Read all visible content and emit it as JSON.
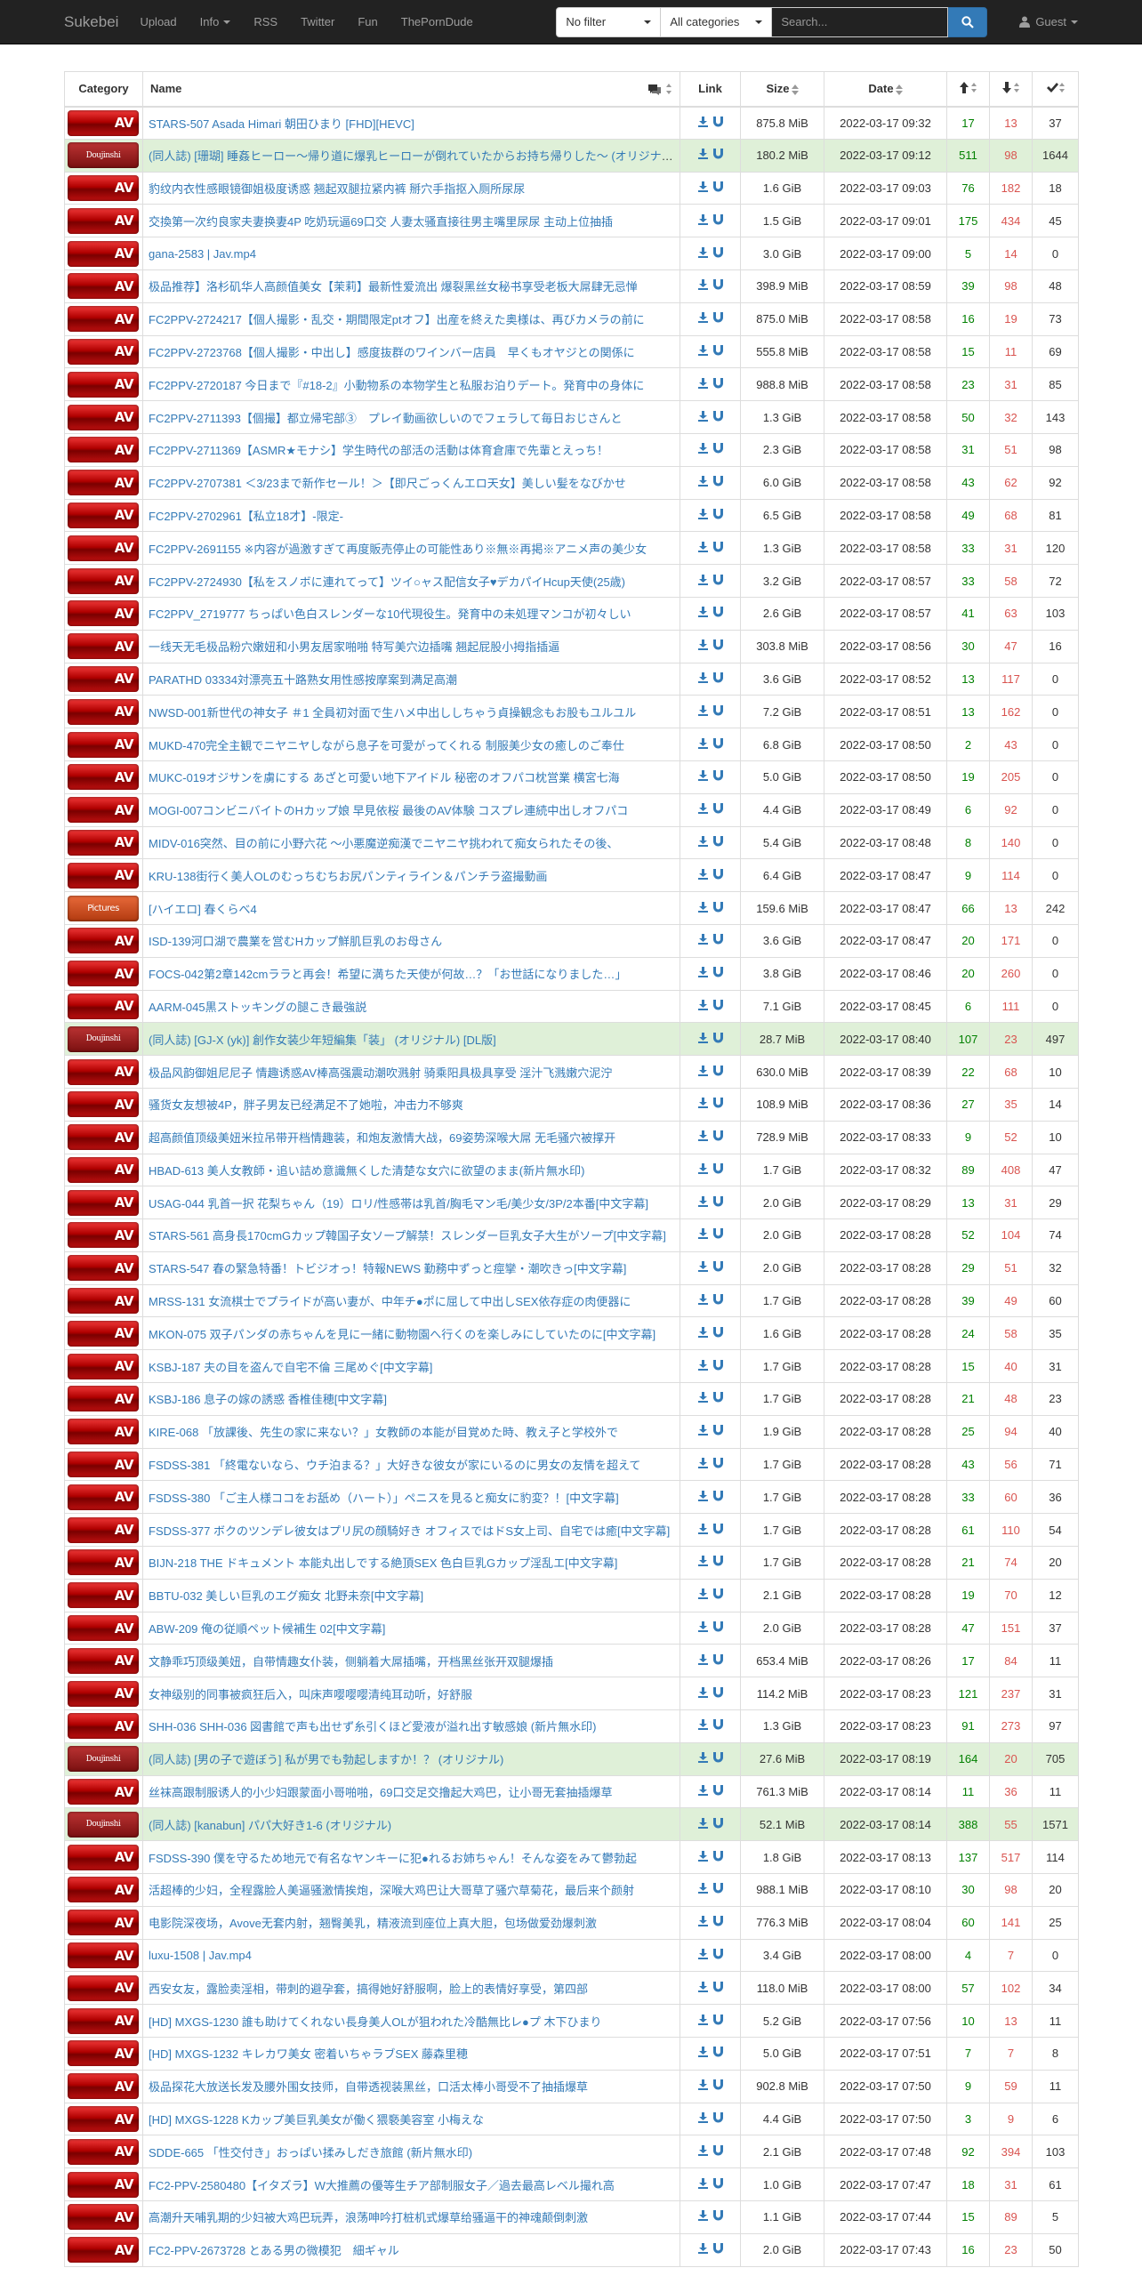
{
  "navbar": {
    "brand": "Sukebei",
    "links": [
      "Upload",
      "Info",
      "RSS",
      "Twitter",
      "Fun",
      "ThePornDude"
    ],
    "filter_value": "No filter",
    "category_value": "All categories",
    "search_placeholder": "Search...",
    "user_label": "Guest"
  },
  "table": {
    "headers": {
      "category": "Category",
      "name": "Name",
      "link": "Link",
      "size": "Size",
      "date": "Date"
    },
    "rows": [
      {
        "cat": "AV",
        "name": "STARS-507 Asada Himari 朝田ひまり [FHD][HEVC]",
        "size": "875.8 MiB",
        "date": "2022-03-17 09:32",
        "s": "17",
        "l": "13",
        "d": "37",
        "hl": false
      },
      {
        "cat": "Doujinshi",
        "name": "(同人誌) [珊瑚] 睡姦ヒーロー～帰り道に爆乳ヒーローが倒れていたからお持ち帰りした～ (オリジナル)",
        "size": "180.2 MiB",
        "date": "2022-03-17 09:12",
        "s": "511",
        "l": "98",
        "d": "1644",
        "hl": true
      },
      {
        "cat": "AV",
        "name": "豹纹内衣性感眼镜御姐极度诱惑 翘起双腿拉紧内裤 掰穴手指抠入厕所尿尿",
        "size": "1.6 GiB",
        "date": "2022-03-17 09:03",
        "s": "76",
        "l": "182",
        "d": "18",
        "hl": false
      },
      {
        "cat": "AV",
        "name": "交換第一次约良家夫妻换妻4P 吃奶玩逼69口交 人妻太骚直接往男主嘴里尿尿 主动上位抽插",
        "size": "1.5 GiB",
        "date": "2022-03-17 09:01",
        "s": "175",
        "l": "434",
        "d": "45",
        "hl": false
      },
      {
        "cat": "AV",
        "name": "gana-2583 | Jav.mp4",
        "size": "3.0 GiB",
        "date": "2022-03-17 09:00",
        "s": "5",
        "l": "14",
        "d": "0",
        "hl": false
      },
      {
        "cat": "AV",
        "name": "极品推荐】洛杉矶华人高颜值美女【茉莉】最新性爱流出 爆裂黑丝女秘书享受老板大屌肆无忌惮",
        "size": "398.9 MiB",
        "date": "2022-03-17 08:59",
        "s": "39",
        "l": "98",
        "d": "48",
        "hl": false
      },
      {
        "cat": "AV",
        "name": "FC2PPV-2724217【個人撮影・乱交・期間限定ptオフ】出産を終えた奥様は、再びカメラの前に",
        "size": "875.0 MiB",
        "date": "2022-03-17 08:58",
        "s": "16",
        "l": "19",
        "d": "73",
        "hl": false
      },
      {
        "cat": "AV",
        "name": "FC2PPV-2723768【個人撮影・中出し】感度抜群のワインバー店員　早くもオヤジとの関係に",
        "size": "555.8 MiB",
        "date": "2022-03-17 08:58",
        "s": "15",
        "l": "11",
        "d": "69",
        "hl": false
      },
      {
        "cat": "AV",
        "name": "FC2PPV-2720187 今日まで『#18-2』小動物系の本物学生と私服お泊りデート。発育中の身体に",
        "size": "988.8 MiB",
        "date": "2022-03-17 08:58",
        "s": "23",
        "l": "31",
        "d": "85",
        "hl": false
      },
      {
        "cat": "AV",
        "name": "FC2PPV-2711393【個撮】都立帰宅部③　プレイ動画欲しいのでフェラして毎日おじさんと",
        "size": "1.3 GiB",
        "date": "2022-03-17 08:58",
        "s": "50",
        "l": "32",
        "d": "143",
        "hl": false
      },
      {
        "cat": "AV",
        "name": "FC2PPV-2711369【ASMR★モナシ】学生時代の部活の活動は体育倉庫で先輩とえっち！",
        "size": "2.3 GiB",
        "date": "2022-03-17 08:58",
        "s": "31",
        "l": "51",
        "d": "98",
        "hl": false
      },
      {
        "cat": "AV",
        "name": "FC2PPV-2707381 ＜3/23まで新作セール！＞【即尺ごっくんエロ天女】美しい髪をなびかせ",
        "size": "6.0 GiB",
        "date": "2022-03-17 08:58",
        "s": "43",
        "l": "62",
        "d": "92",
        "hl": false
      },
      {
        "cat": "AV",
        "name": "FC2PPV-2702961【私立18才】-限定-",
        "size": "6.5 GiB",
        "date": "2022-03-17 08:58",
        "s": "49",
        "l": "68",
        "d": "81",
        "hl": false
      },
      {
        "cat": "AV",
        "name": "FC2PPV-2691155 ※内容が過激すぎて再度販売停止の可能性あり※無※再掲※アニメ声の美少女",
        "size": "1.3 GiB",
        "date": "2022-03-17 08:58",
        "s": "33",
        "l": "31",
        "d": "120",
        "hl": false
      },
      {
        "cat": "AV",
        "name": "FC2PPV-2724930【私をスノボに連れてって】ツイ○ャス配信女子♥デカパイHcup天使(25歳)",
        "size": "3.2 GiB",
        "date": "2022-03-17 08:57",
        "s": "33",
        "l": "58",
        "d": "72",
        "hl": false
      },
      {
        "cat": "AV",
        "name": "FC2PPV_2719777 ちっぱい色白スレンダーな10代現役生。発育中の未処理マンコが初々しい",
        "size": "2.6 GiB",
        "date": "2022-03-17 08:57",
        "s": "41",
        "l": "63",
        "d": "103",
        "hl": false
      },
      {
        "cat": "AV",
        "name": "一线天无毛极品粉穴嫩妞和小男友居家啪啪 特写美穴边插嘴 翘起屁股小拇指插逼",
        "size": "303.8 MiB",
        "date": "2022-03-17 08:56",
        "s": "30",
        "l": "47",
        "d": "16",
        "hl": false
      },
      {
        "cat": "AV",
        "name": "PARATHD 03334対漂亮五十路熟女用性感按摩案到满足高潮",
        "size": "3.6 GiB",
        "date": "2022-03-17 08:52",
        "s": "13",
        "l": "117",
        "d": "0",
        "hl": false
      },
      {
        "cat": "AV",
        "name": "NWSD-001新世代の神女子 ＃1 全員初対面で生ハメ中出ししちゃう貞操観念もお股もユルユル",
        "size": "7.2 GiB",
        "date": "2022-03-17 08:51",
        "s": "13",
        "l": "162",
        "d": "0",
        "hl": false
      },
      {
        "cat": "AV",
        "name": "MUKD-470完全主観でニヤニヤしながら息子を可愛がってくれる 制服美少女の癒しのご奉仕",
        "size": "6.8 GiB",
        "date": "2022-03-17 08:50",
        "s": "2",
        "l": "43",
        "d": "0",
        "hl": false
      },
      {
        "cat": "AV",
        "name": "MUKC-019オジサンを虜にする あざと可愛い地下アイドル 秘密のオフパコ枕営業 横宮七海",
        "size": "5.0 GiB",
        "date": "2022-03-17 08:50",
        "s": "19",
        "l": "205",
        "d": "0",
        "hl": false
      },
      {
        "cat": "AV",
        "name": "MOGI-007コンビニバイトのHカップ娘 早見依桜 最後のAV体験 コスプレ連続中出しオフパコ",
        "size": "4.4 GiB",
        "date": "2022-03-17 08:49",
        "s": "6",
        "l": "92",
        "d": "0",
        "hl": false
      },
      {
        "cat": "AV",
        "name": "MIDV-016突然、目の前に小野六花 ～小悪魔逆痴漢でニヤニヤ挑われて痴女られたその後、",
        "size": "5.4 GiB",
        "date": "2022-03-17 08:48",
        "s": "8",
        "l": "140",
        "d": "0",
        "hl": false
      },
      {
        "cat": "AV",
        "name": "KRU-138街行く美人OLのむっちむちお尻パンティライン＆パンチラ盗撮動画",
        "size": "6.4 GiB",
        "date": "2022-03-17 08:47",
        "s": "9",
        "l": "114",
        "d": "0",
        "hl": false
      },
      {
        "cat": "Pictures",
        "name": "[ハイエロ] 春くらべ4",
        "size": "159.6 MiB",
        "date": "2022-03-17 08:47",
        "s": "66",
        "l": "13",
        "d": "242",
        "hl": false
      },
      {
        "cat": "AV",
        "name": "ISD-139河口湖で農業を営むHカップ鮮肌巨乳のお母さん",
        "size": "3.6 GiB",
        "date": "2022-03-17 08:47",
        "s": "20",
        "l": "171",
        "d": "0",
        "hl": false
      },
      {
        "cat": "AV",
        "name": "FOCS-042第2章142cmララと再会！希望に満ちた天使が何故…？「お世話になりました…」",
        "size": "3.8 GiB",
        "date": "2022-03-17 08:46",
        "s": "20",
        "l": "260",
        "d": "0",
        "hl": false
      },
      {
        "cat": "AV",
        "name": "AARM-045黒ストッキングの腿こき最強説",
        "size": "7.1 GiB",
        "date": "2022-03-17 08:45",
        "s": "6",
        "l": "111",
        "d": "0",
        "hl": false
      },
      {
        "cat": "Doujinshi",
        "name": "(同人誌) [GJ-X (yk)] 創作女装少年短編集「装」 (オリジナル) [DL版]",
        "size": "28.7 MiB",
        "date": "2022-03-17 08:40",
        "s": "107",
        "l": "23",
        "d": "497",
        "hl": true
      },
      {
        "cat": "AV",
        "name": "极品风韵御姐尼尼子 情趣诱惑AV棒高强震动潮吹溅射 骑乘阳具极具享受 淫汁飞溅嫩穴泥泞",
        "size": "630.0 MiB",
        "date": "2022-03-17 08:39",
        "s": "22",
        "l": "68",
        "d": "10",
        "hl": false
      },
      {
        "cat": "AV",
        "name": "骚货女友想被4P，胖子男友已经满足不了她啦，冲击力不够爽",
        "size": "108.9 MiB",
        "date": "2022-03-17 08:36",
        "s": "27",
        "l": "35",
        "d": "14",
        "hl": false
      },
      {
        "cat": "AV",
        "name": "超高颜值顶级美妞米拉吊带开档情趣装，和炮友激情大战，69姿势深喉大屌 无毛骚穴被撑开",
        "size": "728.9 MiB",
        "date": "2022-03-17 08:33",
        "s": "9",
        "l": "52",
        "d": "10",
        "hl": false
      },
      {
        "cat": "AV",
        "name": "HBAD-613 美人女教師・追い詰め意識無くした清楚な女穴に欲望のまま(新片無水印)",
        "size": "1.7 GiB",
        "date": "2022-03-17 08:32",
        "s": "89",
        "l": "408",
        "d": "47",
        "hl": false
      },
      {
        "cat": "AV",
        "name": "USAG-044 乳首一択 花梨ちゃん（19）ロリ/性感帯は乳首/胸毛マン毛/美少女/3P/2本番[中文字幕]",
        "size": "2.0 GiB",
        "date": "2022-03-17 08:29",
        "s": "13",
        "l": "31",
        "d": "29",
        "hl": false
      },
      {
        "cat": "AV",
        "name": "STARS-561 高身長170cmGカップ韓国子女ソープ解禁！スレンダー巨乳女子大生がソープ[中文字幕]",
        "size": "2.0 GiB",
        "date": "2022-03-17 08:28",
        "s": "52",
        "l": "104",
        "d": "74",
        "hl": false
      },
      {
        "cat": "AV",
        "name": "STARS-547 春の緊急特番！トビジオっ！特報NEWS 勤務中ずっと痙攣・潮吹きっ[中文字幕]",
        "size": "2.0 GiB",
        "date": "2022-03-17 08:28",
        "s": "29",
        "l": "51",
        "d": "32",
        "hl": false
      },
      {
        "cat": "AV",
        "name": "MRSS-131 女流棋士でプライドが高い妻が、中年チ●ポに屈して中出しSEX依存症の肉便器に",
        "size": "1.7 GiB",
        "date": "2022-03-17 08:28",
        "s": "39",
        "l": "49",
        "d": "60",
        "hl": false
      },
      {
        "cat": "AV",
        "name": "MKON-075 双子パンダの赤ちゃんを見に一緒に動物園へ行くのを楽しみにしていたのに[中文字幕]",
        "size": "1.6 GiB",
        "date": "2022-03-17 08:28",
        "s": "24",
        "l": "58",
        "d": "35",
        "hl": false
      },
      {
        "cat": "AV",
        "name": "KSBJ-187 夫の目を盗んで自宅不倫 三尾めぐ[中文字幕]",
        "size": "1.7 GiB",
        "date": "2022-03-17 08:28",
        "s": "15",
        "l": "40",
        "d": "31",
        "hl": false
      },
      {
        "cat": "AV",
        "name": "KSBJ-186 息子の嫁の誘惑 香椎佳穂[中文字幕]",
        "size": "1.7 GiB",
        "date": "2022-03-17 08:28",
        "s": "21",
        "l": "48",
        "d": "23",
        "hl": false
      },
      {
        "cat": "AV",
        "name": "KIRE-068 「放課後、先生の家に来ない？」女教師の本能が目覚めた時、教え子と学校外で",
        "size": "1.9 GiB",
        "date": "2022-03-17 08:28",
        "s": "25",
        "l": "94",
        "d": "40",
        "hl": false
      },
      {
        "cat": "AV",
        "name": "FSDSS-381 「終電ないなら、ウチ泊まる？」大好きな彼女が家にいるのに男女の友情を超えて",
        "size": "1.7 GiB",
        "date": "2022-03-17 08:28",
        "s": "43",
        "l": "56",
        "d": "71",
        "hl": false
      },
      {
        "cat": "AV",
        "name": "FSDSS-380 「ご主人様ココをお舐め（ハート）」ペニスを見ると痴女に豹変？！[中文字幕]",
        "size": "1.7 GiB",
        "date": "2022-03-17 08:28",
        "s": "33",
        "l": "60",
        "d": "36",
        "hl": false
      },
      {
        "cat": "AV",
        "name": "FSDSS-377 ボクのツンデレ彼女はプリ尻の顔騎好き オフィスではドS女上司、自宅では癒[中文字幕]",
        "size": "1.7 GiB",
        "date": "2022-03-17 08:28",
        "s": "61",
        "l": "110",
        "d": "54",
        "hl": false
      },
      {
        "cat": "AV",
        "name": "BIJN-218 THE ドキュメント 本能丸出しでする絶頂SEX 色白巨乳Gカップ淫乱エ[中文字幕]",
        "size": "1.7 GiB",
        "date": "2022-03-17 08:28",
        "s": "21",
        "l": "74",
        "d": "20",
        "hl": false
      },
      {
        "cat": "AV",
        "name": "BBTU-032 美しい巨乳のエグ痴女 北野未奈[中文字幕]",
        "size": "2.1 GiB",
        "date": "2022-03-17 08:28",
        "s": "19",
        "l": "70",
        "d": "12",
        "hl": false
      },
      {
        "cat": "AV",
        "name": "ABW-209 俺の従順ペット候補生 02[中文字幕]",
        "size": "2.0 GiB",
        "date": "2022-03-17 08:28",
        "s": "47",
        "l": "151",
        "d": "37",
        "hl": false
      },
      {
        "cat": "AV",
        "name": "文静乖巧顶级美妞，自带情趣女仆装，侧躺着大屌插嘴，开档黑丝张开双腿爆插",
        "size": "653.4 MiB",
        "date": "2022-03-17 08:26",
        "s": "17",
        "l": "84",
        "d": "11",
        "hl": false
      },
      {
        "cat": "AV",
        "name": "女神级别的同事被疯狂后入，叫床声嘤嘤嘤清纯耳动听，好舒服",
        "size": "114.2 MiB",
        "date": "2022-03-17 08:23",
        "s": "121",
        "l": "237",
        "d": "31",
        "hl": false
      },
      {
        "cat": "AV",
        "name": "SHH-036 SHH-036 図書館で声も出せず糸引くほど愛液が溢れ出す敏感娘 (新片無水印)",
        "size": "1.3 GiB",
        "date": "2022-03-17 08:23",
        "s": "91",
        "l": "273",
        "d": "97",
        "hl": false
      },
      {
        "cat": "Doujinshi",
        "name": "(同人誌) [男の子で遊ぼう] 私が男でも勃起しますか！？ (オリジナル)",
        "size": "27.6 MiB",
        "date": "2022-03-17 08:19",
        "s": "164",
        "l": "20",
        "d": "705",
        "hl": true
      },
      {
        "cat": "AV",
        "name": "丝袜高跟制服诱人的小少妇跟蒙面小哥啪啪，69口交足交撸起大鸡巴，让小哥无套抽插爆草",
        "size": "761.3 MiB",
        "date": "2022-03-17 08:14",
        "s": "11",
        "l": "36",
        "d": "11",
        "hl": false
      },
      {
        "cat": "Doujinshi",
        "name": "(同人誌) [kanabun] パパ大好き1-6 (オリジナル)",
        "size": "52.1 MiB",
        "date": "2022-03-17 08:14",
        "s": "388",
        "l": "55",
        "d": "1571",
        "hl": true
      },
      {
        "cat": "AV",
        "name": "FSDSS-390 僕を守るため地元で有名なヤンキーに犯●れるお姉ちゃん！そんな姿をみて鬱勃起",
        "size": "1.8 GiB",
        "date": "2022-03-17 08:13",
        "s": "137",
        "l": "517",
        "d": "114",
        "hl": false
      },
      {
        "cat": "AV",
        "name": "活超棒的少妇，全程露脸人美逼骚激情挨炮，深喉大鸡巴让大哥草了骚穴草菊花，最后来个颜射",
        "size": "988.1 MiB",
        "date": "2022-03-17 08:10",
        "s": "30",
        "l": "98",
        "d": "20",
        "hl": false
      },
      {
        "cat": "AV",
        "name": "电影院深夜场，Avove无套内射，翘臀美乳，精液流到座位上真大胆，包场做爱劲爆刺激",
        "size": "776.3 MiB",
        "date": "2022-03-17 08:04",
        "s": "60",
        "l": "141",
        "d": "25",
        "hl": false
      },
      {
        "cat": "AV",
        "name": "luxu-1508 | Jav.mp4",
        "size": "3.4 GiB",
        "date": "2022-03-17 08:00",
        "s": "4",
        "l": "7",
        "d": "0",
        "hl": false
      },
      {
        "cat": "AV",
        "name": "西安女友，露脸卖淫相，带刺的避孕套，搞得她好舒服啊，脸上的表情好享受，第四部",
        "size": "118.0 MiB",
        "date": "2022-03-17 08:00",
        "s": "57",
        "l": "102",
        "d": "34",
        "hl": false
      },
      {
        "cat": "AV",
        "name": "[HD] MXGS-1230 誰も助けてくれない長身美人OLが狙われた冷酷無比レ●プ 木下ひまり",
        "size": "5.2 GiB",
        "date": "2022-03-17 07:56",
        "s": "10",
        "l": "13",
        "d": "11",
        "hl": false
      },
      {
        "cat": "AV",
        "name": "[HD] MXGS-1232 キレカワ美女 密着いちゃラブSEX 藤森里穂",
        "size": "5.0 GiB",
        "date": "2022-03-17 07:51",
        "s": "7",
        "l": "7",
        "d": "8",
        "hl": false
      },
      {
        "cat": "AV",
        "name": "极品探花大放送长发及腰外围女技师，自带透视装黑丝，口活太棒小哥受不了抽插爆草",
        "size": "902.8 MiB",
        "date": "2022-03-17 07:50",
        "s": "9",
        "l": "59",
        "d": "11",
        "hl": false
      },
      {
        "cat": "AV",
        "name": "[HD] MXGS-1228 Kカップ美巨乳美女が働く猥褻美容室 小梅えな",
        "size": "4.4 GiB",
        "date": "2022-03-17 07:50",
        "s": "3",
        "l": "9",
        "d": "6",
        "hl": false
      },
      {
        "cat": "AV",
        "name": "SDDE-665 「性交付き」おっぱい揉みしだき旅館 (新片無水印)",
        "size": "2.1 GiB",
        "date": "2022-03-17 07:48",
        "s": "92",
        "l": "394",
        "d": "103",
        "hl": false
      },
      {
        "cat": "AV",
        "name": "FC2-PPV-2580480【イタズラ】W大推薦の優等生チア部制服女子／過去最高レベル撮れ高",
        "size": "1.0 GiB",
        "date": "2022-03-17 07:47",
        "s": "18",
        "l": "31",
        "d": "61",
        "hl": false
      },
      {
        "cat": "AV",
        "name": "高潮升天哺乳期的少妇被大鸡巴玩弄，浪荡呻吟打桩机式爆草给骚逼干的神魂颠倒刺激",
        "size": "1.1 GiB",
        "date": "2022-03-17 07:44",
        "s": "15",
        "l": "89",
        "d": "5",
        "hl": false
      },
      {
        "cat": "AV",
        "name": "FC2-PPV-2673728 とある男の微模犯　細ギャル",
        "size": "2.0 GiB",
        "date": "2022-03-17 07:43",
        "s": "16",
        "l": "23",
        "d": "50",
        "hl": false
      }
    ]
  },
  "colors": {
    "seed": "#008000",
    "leech": "#d9534f",
    "link": "#337ab7",
    "highlight": "#dff0d8"
  }
}
